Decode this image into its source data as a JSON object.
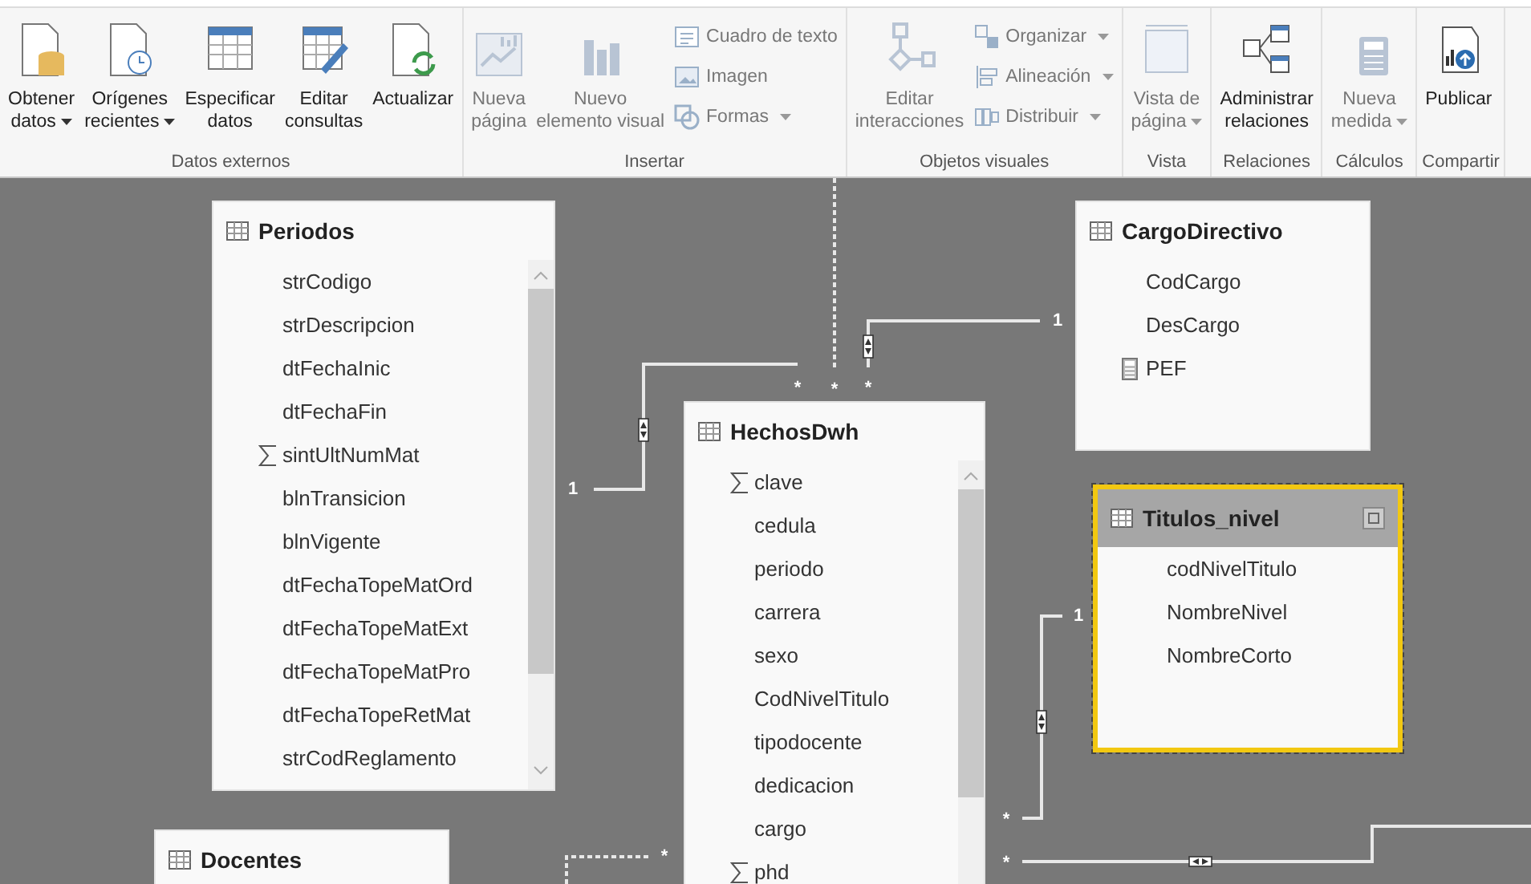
{
  "ribbon": {
    "groups": [
      {
        "label": "Datos externos",
        "buttons": [
          {
            "kind": "large",
            "lines": [
              "Obtener",
              "datos"
            ],
            "dropdown": true,
            "disabled": false
          },
          {
            "kind": "large",
            "lines": [
              "Orígenes",
              "recientes"
            ],
            "dropdown": true,
            "disabled": false
          },
          {
            "kind": "large",
            "lines": [
              "Especificar",
              "datos"
            ],
            "dropdown": false,
            "disabled": false
          },
          {
            "kind": "large",
            "lines": [
              "Editar",
              "consultas"
            ],
            "dropdown": false,
            "disabled": false
          },
          {
            "kind": "large",
            "lines": [
              "Actualizar"
            ],
            "dropdown": false,
            "disabled": false
          }
        ]
      },
      {
        "label": "Insertar",
        "buttons": [
          {
            "kind": "large",
            "lines": [
              "Nueva",
              "página"
            ],
            "dropdown": false,
            "disabled": true
          },
          {
            "kind": "large",
            "lines": [
              "Nuevo",
              "elemento visual"
            ],
            "dropdown": false,
            "disabled": true
          },
          {
            "kind": "small",
            "lines": [
              "Cuadro de texto"
            ],
            "dropdown": false,
            "disabled": true
          },
          {
            "kind": "small",
            "lines": [
              "Imagen"
            ],
            "dropdown": false,
            "disabled": true
          },
          {
            "kind": "small",
            "lines": [
              "Formas"
            ],
            "dropdown": true,
            "disabled": true
          }
        ]
      },
      {
        "label": "Objetos visuales",
        "buttons": [
          {
            "kind": "large",
            "lines": [
              "Editar",
              "interacciones"
            ],
            "dropdown": false,
            "disabled": true
          },
          {
            "kind": "small",
            "lines": [
              "Organizar"
            ],
            "dropdown": true,
            "disabled": true
          },
          {
            "kind": "small",
            "lines": [
              "Alineación"
            ],
            "dropdown": true,
            "disabled": true
          },
          {
            "kind": "small",
            "lines": [
              "Distribuir"
            ],
            "dropdown": true,
            "disabled": true
          }
        ]
      },
      {
        "label": "Vista",
        "buttons": [
          {
            "kind": "large",
            "lines": [
              "Vista de",
              "página"
            ],
            "dropdown": true,
            "disabled": true
          }
        ]
      },
      {
        "label": "Relaciones",
        "buttons": [
          {
            "kind": "large",
            "lines": [
              "Administrar",
              "relaciones"
            ],
            "dropdown": false,
            "disabled": false
          }
        ]
      },
      {
        "label": "Cálculos",
        "buttons": [
          {
            "kind": "large",
            "lines": [
              "Nueva",
              "medida"
            ],
            "dropdown": true,
            "disabled": true
          }
        ]
      },
      {
        "label": "Compartir",
        "buttons": [
          {
            "kind": "large",
            "lines": [
              "Publicar"
            ],
            "dropdown": false,
            "disabled": false
          }
        ]
      }
    ]
  },
  "canvas": {
    "tables": [
      {
        "name": "Periodos",
        "selected": false,
        "fields": [
          {
            "name": "strCodigo",
            "kind": "plain"
          },
          {
            "name": "strDescripcion",
            "kind": "plain"
          },
          {
            "name": "dtFechaInic",
            "kind": "plain"
          },
          {
            "name": "dtFechaFin",
            "kind": "plain"
          },
          {
            "name": "sintUltNumMat",
            "kind": "sum"
          },
          {
            "name": "blnTransicion",
            "kind": "plain"
          },
          {
            "name": "blnVigente",
            "kind": "plain"
          },
          {
            "name": "dtFechaTopeMatOrd",
            "kind": "plain"
          },
          {
            "name": "dtFechaTopeMatExt",
            "kind": "plain"
          },
          {
            "name": "dtFechaTopeMatPro",
            "kind": "plain"
          },
          {
            "name": "dtFechaTopeRetMat",
            "kind": "plain"
          },
          {
            "name": "strCodReglamento",
            "kind": "plain"
          }
        ]
      },
      {
        "name": "HechosDwh",
        "selected": false,
        "fields": [
          {
            "name": "clave",
            "kind": "sum"
          },
          {
            "name": "cedula",
            "kind": "plain"
          },
          {
            "name": "periodo",
            "kind": "plain"
          },
          {
            "name": "carrera",
            "kind": "plain"
          },
          {
            "name": "sexo",
            "kind": "plain"
          },
          {
            "name": "CodNivelTitulo",
            "kind": "plain"
          },
          {
            "name": "tipodocente",
            "kind": "plain"
          },
          {
            "name": "dedicacion",
            "kind": "plain"
          },
          {
            "name": "cargo",
            "kind": "plain"
          },
          {
            "name": "phd",
            "kind": "sum"
          }
        ]
      },
      {
        "name": "CargoDirectivo",
        "selected": false,
        "fields": [
          {
            "name": "CodCargo",
            "kind": "plain"
          },
          {
            "name": "DesCargo",
            "kind": "plain"
          },
          {
            "name": "PEF",
            "kind": "measure"
          }
        ]
      },
      {
        "name": "Titulos_nivel",
        "selected": true,
        "fields": [
          {
            "name": "codNivelTitulo",
            "kind": "plain"
          },
          {
            "name": "NombreNivel",
            "kind": "plain"
          },
          {
            "name": "NombreCorto",
            "kind": "plain"
          }
        ]
      },
      {
        "name": "Docentes",
        "selected": false
      }
    ],
    "relationships": [
      {
        "active": true,
        "one_label": "1",
        "many_label": "*"
      },
      {
        "active": false,
        "many_label": "*"
      },
      {
        "active": true,
        "one_label": "1",
        "many_label": "*"
      },
      {
        "active": true,
        "one_label": "1",
        "many_label": "*"
      },
      {
        "active": true,
        "many_label": "*"
      },
      {
        "active": false,
        "many_label": "*"
      }
    ]
  }
}
